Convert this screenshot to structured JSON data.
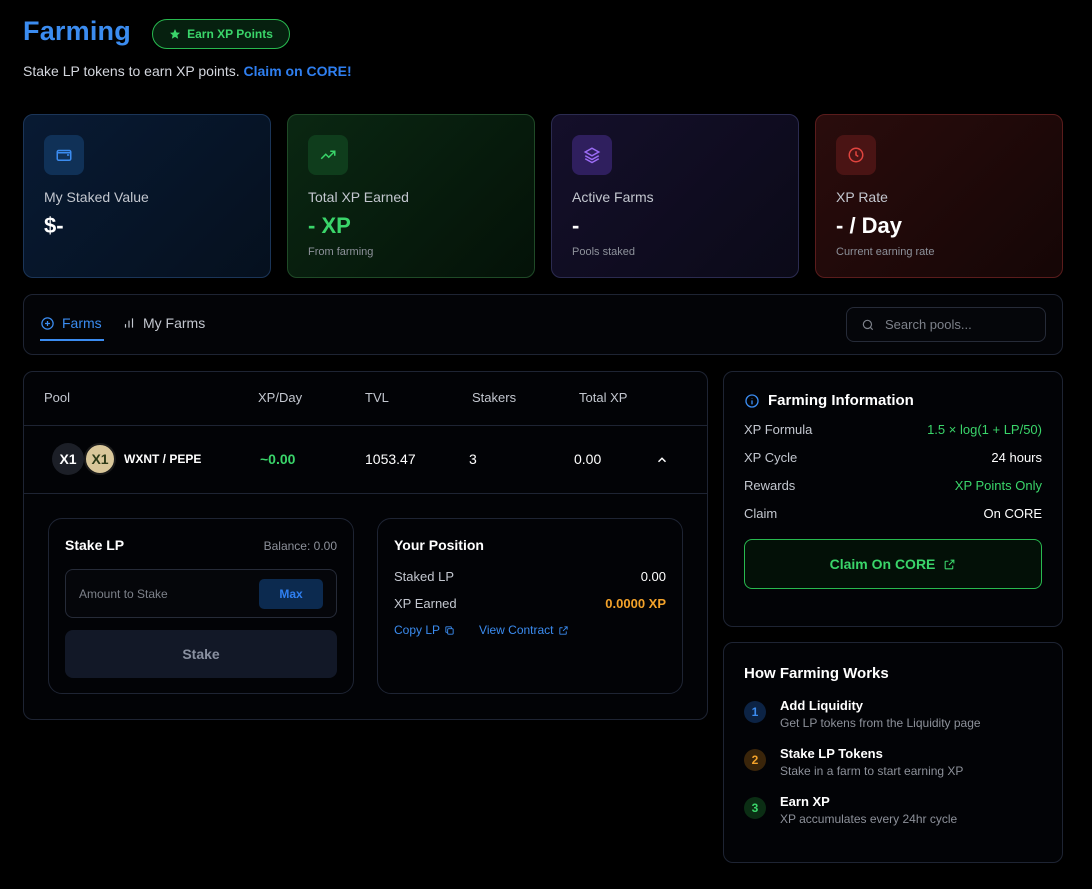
{
  "header": {
    "title": "Farming",
    "badge": "Earn XP Points",
    "subtitle": "Stake LP tokens to earn XP points.",
    "subtitle_link": "Claim on CORE!"
  },
  "stats": [
    {
      "label": "My Staked Value",
      "value": "$-",
      "note": "",
      "icon": "wallet-icon",
      "color": "#3b8cf0"
    },
    {
      "label": "Total XP Earned",
      "value": "- XP",
      "note": "From farming",
      "icon": "trending-up-icon",
      "color": "#3ad56a"
    },
    {
      "label": "Active Farms",
      "value": "-",
      "note": "Pools staked",
      "icon": "layers-icon",
      "color": "#9b6cf5"
    },
    {
      "label": "XP Rate",
      "value": "- / Day",
      "note": "Current earning rate",
      "icon": "clock-icon",
      "color": "#e0443e"
    }
  ],
  "tabs": [
    {
      "label": "Farms",
      "icon": "plus-circle-icon",
      "active": true
    },
    {
      "label": "My Farms",
      "icon": "bar-chart-icon",
      "active": false
    }
  ],
  "search": {
    "placeholder": "Search pools..."
  },
  "table": {
    "headers": [
      "Pool",
      "XP/Day",
      "TVL",
      "Stakers",
      "Total XP"
    ],
    "rows": [
      {
        "token_a": "X1",
        "token_b": "X1",
        "pair": "WXNT / PEPE",
        "xp_day": "~0.00",
        "tvl": "1053.47",
        "stakers": "3",
        "total_xp": "0.00"
      }
    ]
  },
  "stake": {
    "title": "Stake LP",
    "balance": "Balance: 0.00",
    "placeholder": "Amount to Stake",
    "max": "Max",
    "button": "Stake"
  },
  "position": {
    "title": "Your Position",
    "staked_label": "Staked LP",
    "staked_value": "0.00",
    "earned_label": "XP Earned",
    "earned_value": "0.0000 XP",
    "copy_link": "Copy LP",
    "contract_link": "View Contract"
  },
  "info": {
    "title": "Farming Information",
    "rows": [
      {
        "label": "XP Formula",
        "value": "1.5 × log(1 + LP/50)"
      },
      {
        "label": "XP Cycle",
        "value": "24 hours"
      },
      {
        "label": "Rewards",
        "value": "XP Points Only"
      },
      {
        "label": "Claim",
        "value": "On CORE"
      }
    ],
    "claim_button": "Claim On CORE"
  },
  "how": {
    "title": "How Farming Works",
    "steps": [
      {
        "num": "1",
        "title": "Add Liquidity",
        "desc": "Get LP tokens from the Liquidity page"
      },
      {
        "num": "2",
        "title": "Stake LP Tokens",
        "desc": "Stake in a farm to start earning XP"
      },
      {
        "num": "3",
        "title": "Earn XP",
        "desc": "XP accumulates every 24hr cycle"
      }
    ]
  }
}
